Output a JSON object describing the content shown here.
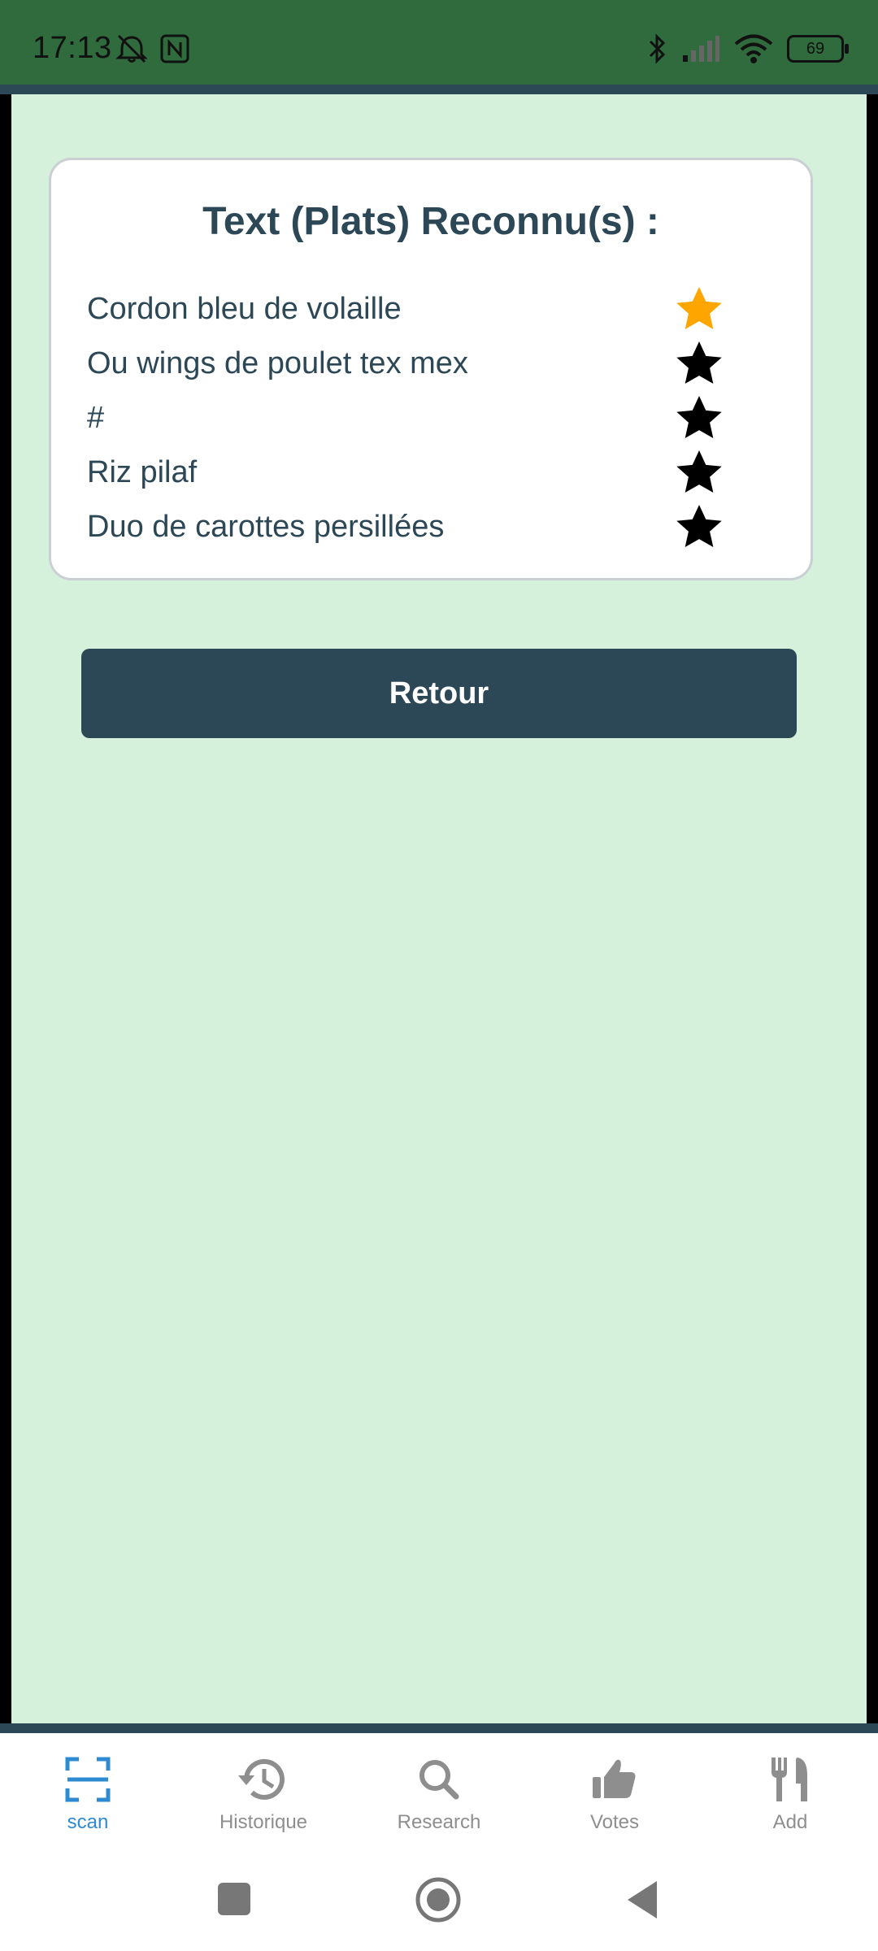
{
  "status_bar": {
    "time": "17:13",
    "battery_level": "69",
    "icons": [
      "alarm-off-icon",
      "nfc-icon",
      "bluetooth-icon",
      "cell-signal-icon",
      "wifi-icon",
      "battery-icon"
    ]
  },
  "card": {
    "title": "Text (Plats) Reconnu(s) :",
    "items": [
      {
        "label": "Cordon bleu de volaille",
        "starred": true
      },
      {
        "label": "Ou wings de poulet tex mex",
        "starred": false
      },
      {
        "label": "#",
        "starred": false
      },
      {
        "label": "Riz pilaf",
        "starred": false
      },
      {
        "label": "Duo de carottes persillées",
        "starred": false
      }
    ]
  },
  "back_button": {
    "label": "Retour"
  },
  "bottom_nav": {
    "items": [
      {
        "label": "scan",
        "icon": "scan-icon",
        "active": true
      },
      {
        "label": "Historique",
        "icon": "history-icon",
        "active": false
      },
      {
        "label": "Research",
        "icon": "search-icon",
        "active": false
      },
      {
        "label": "Votes",
        "icon": "thumbs-up-icon",
        "active": false
      },
      {
        "label": "Add",
        "icon": "utensils-icon",
        "active": false
      }
    ]
  },
  "colors": {
    "status_bar": "#2f6b3c",
    "background": "#d5f1dc",
    "primary": "#2c4756",
    "star_active": "#ffa500",
    "star_inactive": "#000000",
    "nav_active": "#2f8bd1",
    "nav_inactive": "#8e8e8e"
  }
}
